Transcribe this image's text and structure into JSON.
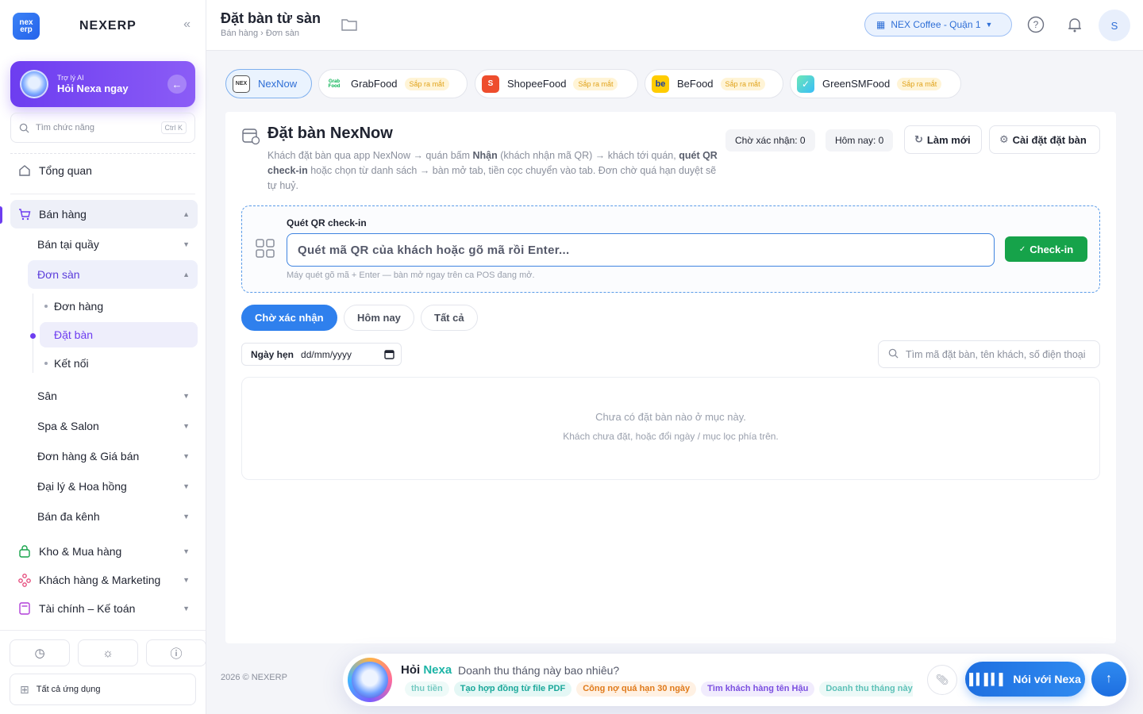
{
  "sidebar": {
    "brand": "NEXERP",
    "logo_text": "nex erp",
    "ai_card": {
      "small": "Trợ lý AI",
      "big": "Hỏi Nexa ngay"
    },
    "search": {
      "placeholder": "Tìm chức năng",
      "shortcut": "Ctrl K"
    },
    "overview": "Tổng quan",
    "sales": "Bán hàng",
    "sales_sub": {
      "counter": "Bán tại quầy",
      "platform": "Đơn sàn",
      "platform_items": [
        "Đơn hàng",
        "Đặt bàn",
        "Kết nối"
      ],
      "court": "Sân",
      "spa": "Spa & Salon",
      "orders_price": "Đơn hàng & Giá bán",
      "agency": "Đại lý & Hoa hồng",
      "multichannel": "Bán đa kênh"
    },
    "warehouse": "Kho & Mua hàng",
    "customers": "Khách hàng & Marketing",
    "finance": "Tài chính – Kế toán",
    "all_apps": "Tất cả ứng dụng"
  },
  "header": {
    "title": "Đặt bàn từ sàn",
    "breadcrumb": "Bán hàng › Đơn sàn",
    "store": "NEX Coffee - Quận 1",
    "user_initial": "S"
  },
  "channels": [
    {
      "name": "NexNow",
      "logo": "NEX",
      "soon": ""
    },
    {
      "name": "GrabFood",
      "logo": "Grab Food",
      "soon": "Sắp ra mắt"
    },
    {
      "name": "ShopeeFood",
      "logo": "S",
      "soon": "Sắp ra mắt"
    },
    {
      "name": "BeFood",
      "logo": "be",
      "soon": "Sắp ra mắt"
    },
    {
      "name": "GreenSMFood",
      "logo": "✓",
      "soon": "Sắp ra mắt"
    }
  ],
  "card": {
    "title": "Đặt bàn NexNow",
    "desc_1": "Khách đặt bàn qua app NexNow → quán bấm ",
    "desc_b1": "Nhận",
    "desc_2": " (khách nhận mã QR) → khách tới quán, ",
    "desc_b2": "quét QR check-in",
    "desc_3": " hoặc chọn từ danh sách → bàn mở tab, tiền cọc chuyển vào tab. Đơn chờ quá hạn duyệt sẽ tự huỷ.",
    "pending_count": "Chờ xác nhận: 0",
    "today_count": "Hôm nay: 0",
    "refresh": "Làm mới",
    "settings": "Cài đặt đặt bàn",
    "qr": {
      "label": "Quét QR check-in",
      "placeholder": "Quét mã QR của khách hoặc gõ mã rồi Enter...",
      "button": "Check-in",
      "hint": "Máy quét gõ mã + Enter — bàn mở ngay trên ca POS đang mở."
    },
    "filters": [
      "Chờ xác nhận",
      "Hôm nay",
      "Tất cả"
    ],
    "date_label": "Ngày hẹn",
    "date_placeholder": "dd/mm/yyyy",
    "search_placeholder": "Tìm mã đặt bàn, tên khách, số điện thoại",
    "empty_1": "Chưa có đặt bàn nào ở mục này.",
    "empty_2": "Khách chưa đặt, hoặc đổi ngày / mục lọc phía trên."
  },
  "footer": "2026 © NEXERP",
  "nexa": {
    "title_a": "Hỏi ",
    "title_b": "Nexa",
    "question": "Doanh thu tháng này bao nhiêu?",
    "chips": [
      "thu tiền",
      "Tạo hợp đồng từ file PDF",
      "Công nợ quá hạn 30 ngày",
      "Tìm khách hàng tên Hậu",
      "Doanh thu tháng này"
    ],
    "talk": "Nói với Nexa"
  },
  "colors": {
    "accent": "#2f80ed",
    "purple": "#6d3df0",
    "success": "#16a34a"
  }
}
